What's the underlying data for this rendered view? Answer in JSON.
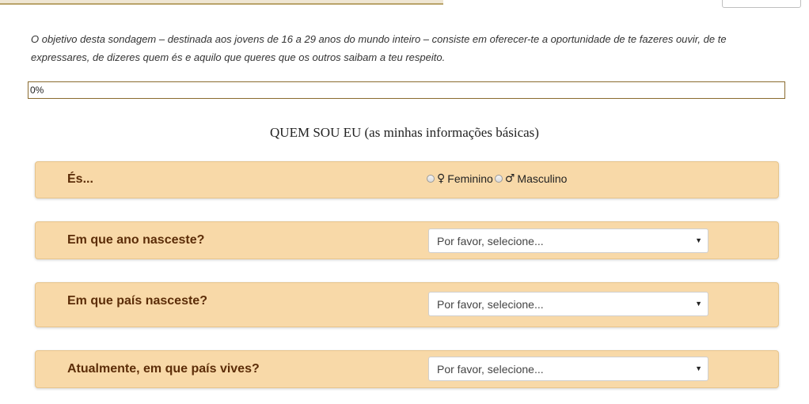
{
  "intro": "O objetivo desta sondagem – destinada aos jovens de 16 a 29 anos do mundo inteiro – consiste em oferecer-te a oportunidade de te fazeres ouvir, de te expressares, de dizeres quem és e aquilo que queres que os outros saibam a teu respeito.",
  "progress": {
    "label": "0%",
    "value": 0
  },
  "section_title": "QUEM SOU EU (as minhas informações básicas)",
  "questions": {
    "gender": {
      "label": "És...",
      "options": [
        {
          "symbol": "♀",
          "label": "Feminino"
        },
        {
          "symbol": "♂",
          "label": "Masculino"
        }
      ]
    },
    "birth_year": {
      "label": "Em que ano nasceste?",
      "selected": "Por favor, selecione..."
    },
    "birth_country": {
      "label": "Em que país nasceste?",
      "selected": "Por favor, selecione..."
    },
    "current_country": {
      "label": "Atualmente, em que país vives?",
      "selected": "Por favor, selecione..."
    }
  },
  "colors": {
    "panel": "#f8d9a8",
    "label_text": "#5c2d08",
    "progress_border": "#8a6b2f"
  }
}
